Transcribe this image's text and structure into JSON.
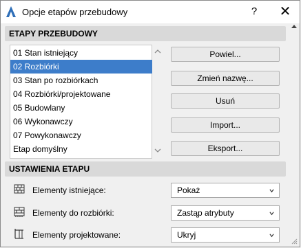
{
  "window": {
    "title": "Opcje etapów przebudowy",
    "help_label": "?",
    "close_label": "✕"
  },
  "phases_section": {
    "header": "ETAPY PRZEBUDOWY",
    "items": [
      {
        "label": "01 Stan istniejący",
        "selected": false
      },
      {
        "label": "02 Rozbiórki",
        "selected": true
      },
      {
        "label": "03 Stan po rozbiórkach",
        "selected": false
      },
      {
        "label": "04 Rozbiórki/projektowane",
        "selected": false
      },
      {
        "label": "05 Budowlany",
        "selected": false
      },
      {
        "label": "06 Wykonawczy",
        "selected": false
      },
      {
        "label": "07 Powykonawczy",
        "selected": false
      },
      {
        "label": "Etap domyślny",
        "selected": false
      }
    ],
    "buttons": {
      "duplicate": "Powiel...",
      "rename": "Zmień nazwę...",
      "delete": "Usuń",
      "import": "Import...",
      "export": "Eksport..."
    }
  },
  "settings_section": {
    "header": "USTAWIENIA ETAPU",
    "rows": [
      {
        "icon": "existing-elements-icon",
        "label": "Elementy istniejące:",
        "value": "Pokaż"
      },
      {
        "icon": "demolish-elements-icon",
        "label": "Elementy do rozbiórki:",
        "value": "Zastąp atrybuty"
      },
      {
        "icon": "new-elements-icon",
        "label": "Elementy projektowane:",
        "value": "Ukryj"
      }
    ]
  },
  "colors": {
    "selection": "#3d7dca",
    "header_bg": "#d9d9d9",
    "window_bg": "#f0f0f0"
  }
}
